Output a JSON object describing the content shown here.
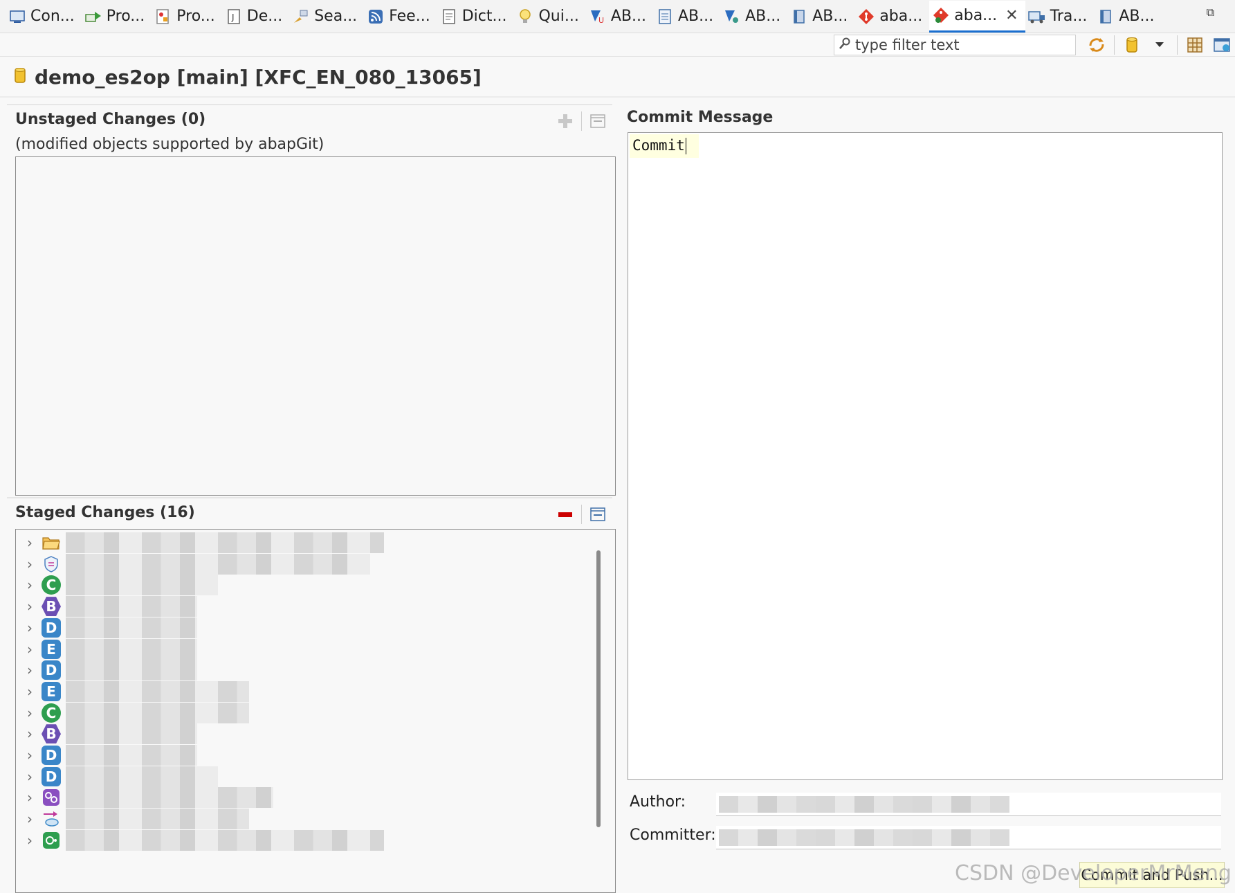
{
  "tabs": [
    {
      "label": "Con...",
      "icon": "console-icon",
      "active": false
    },
    {
      "label": "Pro...",
      "icon": "progress-icon",
      "active": false
    },
    {
      "label": "Pro...",
      "icon": "problems-icon",
      "active": false
    },
    {
      "label": "De...",
      "icon": "javadoc-icon",
      "active": false
    },
    {
      "label": "Sea...",
      "icon": "search-icon",
      "active": false
    },
    {
      "label": "Fee...",
      "icon": "feed-icon",
      "active": false
    },
    {
      "label": "Dict...",
      "icon": "dictionary-icon",
      "active": false
    },
    {
      "label": "Qui...",
      "icon": "lightbulb-icon",
      "active": false
    },
    {
      "label": "AB...",
      "icon": "abap-unit-icon",
      "active": false
    },
    {
      "label": "AB...",
      "icon": "abap-doc-icon",
      "active": false
    },
    {
      "label": "AB...",
      "icon": "abap-coverage-icon",
      "active": false
    },
    {
      "label": "AB...",
      "icon": "abap-book-icon",
      "active": false
    },
    {
      "label": "aba...",
      "icon": "git-icon",
      "active": false
    },
    {
      "label": "aba...",
      "icon": "git-staging-icon",
      "active": true
    },
    {
      "label": "Tra...",
      "icon": "transport-icon",
      "active": false
    },
    {
      "label": "AB...",
      "icon": "abap-book-icon",
      "active": false
    }
  ],
  "filter": {
    "placeholder": "type filter text"
  },
  "header": {
    "title": "demo_es2op [main] [XFC_EN_080_13065]"
  },
  "unstaged": {
    "title": "Unstaged Changes (0)",
    "subtitle": "(modified objects supported by abapGit)"
  },
  "staged": {
    "title": "Staged Changes (16)",
    "items": [
      {
        "icon": "folder-icon",
        "badge": "",
        "color": "#e8a33a"
      },
      {
        "icon": "shield-icon",
        "badge": "",
        "color": "#4a7fc1"
      },
      {
        "icon": "class-icon",
        "badge": "C",
        "color": "#2e9e4f"
      },
      {
        "icon": "behavior-icon",
        "badge": "B",
        "color": "#6b4fb3"
      },
      {
        "icon": "data-definition-icon",
        "badge": "D",
        "color": "#3a86c8"
      },
      {
        "icon": "entity-icon",
        "badge": "E",
        "color": "#3a86c8"
      },
      {
        "icon": "data-definition-icon",
        "badge": "D",
        "color": "#3a86c8"
      },
      {
        "icon": "entity-icon",
        "badge": "E",
        "color": "#3a86c8"
      },
      {
        "icon": "class-icon",
        "badge": "C",
        "color": "#2e9e4f"
      },
      {
        "icon": "behavior-icon",
        "badge": "B",
        "color": "#6b4fb3"
      },
      {
        "icon": "data-definition-icon",
        "badge": "D",
        "color": "#3a86c8"
      },
      {
        "icon": "data-definition-icon",
        "badge": "D",
        "color": "#3a86c8"
      },
      {
        "icon": "service-binding-icon",
        "badge": "",
        "color": "#8a4fc0"
      },
      {
        "icon": "transport-arrow-icon",
        "badge": "",
        "color": "#c0399a"
      },
      {
        "icon": "service-definition-icon",
        "badge": "",
        "color": "#2e9e4f"
      }
    ]
  },
  "commit": {
    "title": "Commit Message",
    "message": "Commit",
    "author_label": "Author:",
    "committer_label": "Committer:",
    "button_label": "Commit and Push..."
  },
  "watermark": "CSDN @DeveloperMrMeng",
  "colors": {
    "accent": "#1a6fd0",
    "remove": "#cc0000",
    "highlight": "#ffffe0"
  }
}
